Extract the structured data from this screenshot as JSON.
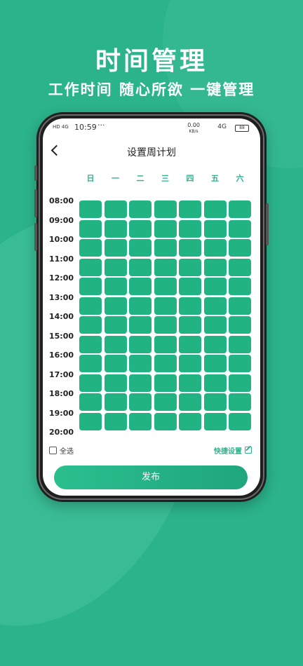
{
  "promo": {
    "headline": "时间管理",
    "subline": "工作时间 随心所欲 一键管理"
  },
  "status_bar": {
    "left": "HD 4G",
    "time": "10:59",
    "dots": "···",
    "net_speed": "0.00",
    "net_unit": "KB/s",
    "signal": "4G",
    "battery": "88"
  },
  "nav": {
    "title": "设置周计划"
  },
  "days": [
    "日",
    "一",
    "二",
    "三",
    "四",
    "五",
    "六"
  ],
  "times": [
    "08:00",
    "09:00",
    "10:00",
    "11:00",
    "12:00",
    "13:00",
    "14:00",
    "15:00",
    "16:00",
    "17:00",
    "18:00",
    "19:00",
    "20:00"
  ],
  "slots_per_day": 12,
  "colors": {
    "accent": "#2bb38c",
    "cell": "#22b383"
  },
  "footer": {
    "select_all": "全选",
    "quick_set": "快捷设置"
  },
  "publish_label": "发布"
}
